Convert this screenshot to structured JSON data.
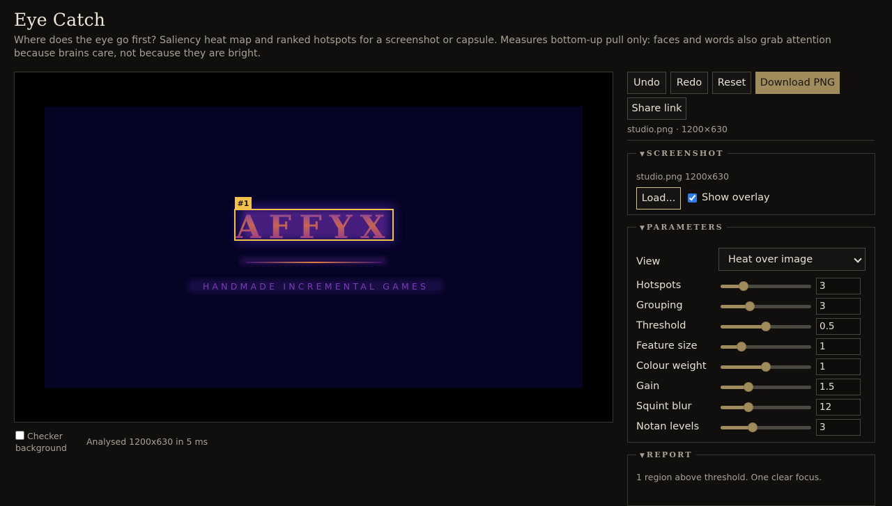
{
  "app": {
    "title": "Eye Catch",
    "description": "Where does the eye go first? Saliency heat map and ranked hotspots for a screenshot or capsule. Measures bottom-up pull only: faces and words also grab attention because brains care, not because they are bright."
  },
  "preview": {
    "logo_text": "AFFYX",
    "tagline": "HANDMADE INCREMENTAL GAMES",
    "hotspot_badge": "#1",
    "checker_label": "Checker background",
    "checker_checked": false,
    "status": "Analysed 1200x630 in 5 ms"
  },
  "toolbar": {
    "undo": "Undo",
    "redo": "Redo",
    "reset": "Reset",
    "download": "Download PNG",
    "share": "Share link",
    "file_meta": "studio.png · 1200×630"
  },
  "screenshot_panel": {
    "legend": "SCREENSHOT",
    "file_name": "studio.png 1200x630",
    "load_label": "Load...",
    "overlay_label": "Show overlay",
    "overlay_checked": true
  },
  "parameters_panel": {
    "legend": "PARAMETERS",
    "view_label": "View",
    "view_value": "Heat over image",
    "params": [
      {
        "label": "Hotspots",
        "value": "3",
        "position": 0.25
      },
      {
        "label": "Grouping",
        "value": "3",
        "position": 0.32
      },
      {
        "label": "Threshold",
        "value": "0.5",
        "position": 0.5
      },
      {
        "label": "Feature size",
        "value": "1",
        "position": 0.23
      },
      {
        "label": "Colour weight",
        "value": "1",
        "position": 0.5
      },
      {
        "label": "Gain",
        "value": "1.5",
        "position": 0.31
      },
      {
        "label": "Squint blur",
        "value": "12",
        "position": 0.31
      },
      {
        "label": "Notan levels",
        "value": "3",
        "position": 0.35
      }
    ]
  },
  "report_panel": {
    "legend": "REPORT",
    "summary": "1 region above threshold. One clear focus."
  },
  "colors": {
    "accent": "#a08b5d",
    "hotspot": "#f2c14e",
    "background": "#100f0e"
  }
}
